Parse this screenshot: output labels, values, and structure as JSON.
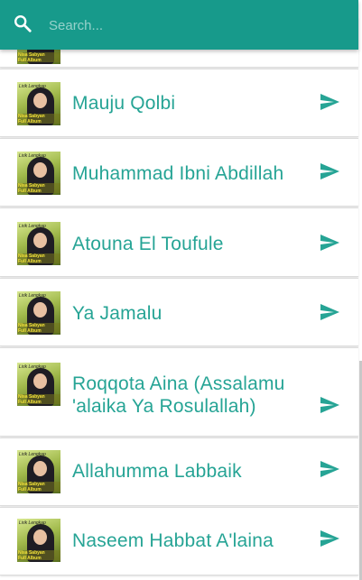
{
  "search": {
    "placeholder": "Search..."
  },
  "accent_color": "#179a8b",
  "title_color": "#26a495",
  "items": [
    {
      "title": "Mauju Qolbi"
    },
    {
      "title": "Muhammad Ibni Abdillah"
    },
    {
      "title": "Atouna El Toufule"
    },
    {
      "title": "Ya Jamalu"
    },
    {
      "title": "Roqqota Aina (Assalamu 'alaika Ya Rosulallah)"
    },
    {
      "title": "Allahumma Labbaik"
    },
    {
      "title": "Naseem Habbat A'laina"
    }
  ],
  "thumbnail": {
    "caption_top": "Nisa Sabyan",
    "caption_mid": "Lirik Lengkap",
    "caption_bottom": "Full Album"
  },
  "icons": {
    "search": "search-icon",
    "item_action": "send-icon"
  }
}
